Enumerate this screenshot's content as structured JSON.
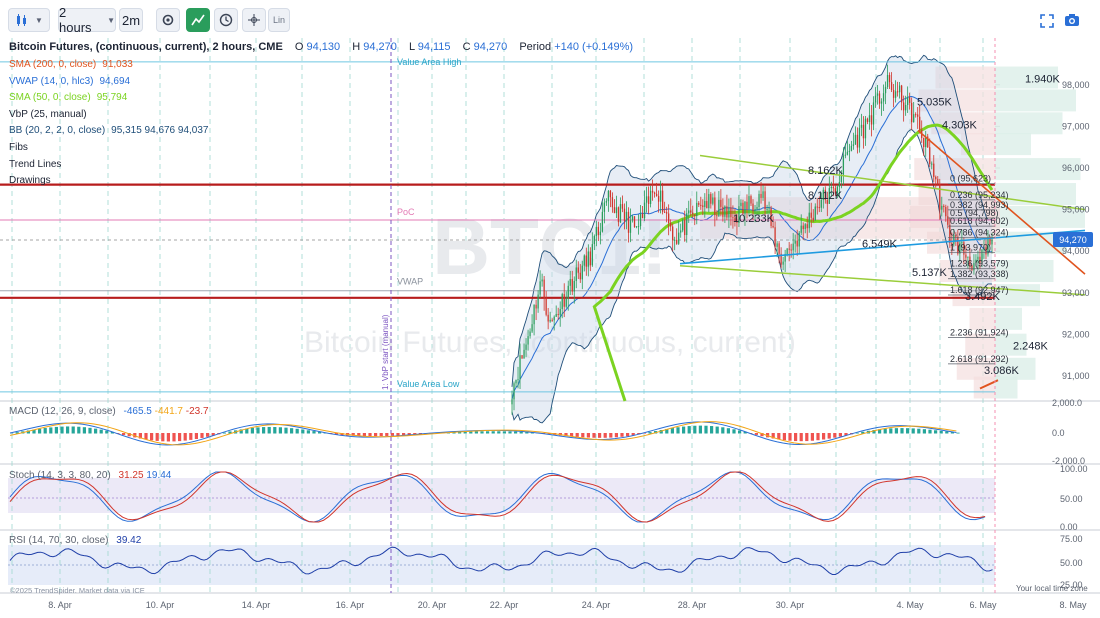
{
  "toolbar": {
    "interval": "2 hours",
    "refresh": "2m",
    "log_label": "Lin"
  },
  "header": {
    "title": "Bitcoin Futures, (continuous, current), 2 hours, CME",
    "open_key": "O",
    "open": "94,130",
    "high_key": "H",
    "high": "94,270",
    "low_key": "L",
    "low": "94,115",
    "close_key": "C",
    "close": "94,270",
    "period_key": "Period",
    "period": "+140 (+0.149%)"
  },
  "legend": [
    {
      "name": "SMA (200, 0, close)",
      "value": "91,033",
      "color": "#e0541f"
    },
    {
      "name": "VWAP (14, 0, hlc3)",
      "value": "94,694",
      "color": "#2a6fd6"
    },
    {
      "name": "SMA (50, 0, close)",
      "value": "95,794",
      "color": "#7bd321"
    },
    {
      "name": "VbP (25, manual)",
      "value": "",
      "color": "#1c2333"
    },
    {
      "name": "BB (20, 2, 2, 0, close)",
      "value": "95,315 94,676 94,037",
      "color": "#1f4e79"
    },
    {
      "name": "Fibs",
      "value": "",
      "color": "#1c2333"
    },
    {
      "name": "Trend Lines",
      "value": "",
      "color": "#1c2333"
    },
    {
      "name": "Drawings",
      "value": "",
      "color": "#1c2333"
    }
  ],
  "annotations": {
    "value_area_high": "Value Area High",
    "poc": "PoC",
    "vwap": "VWAP",
    "value_area_low": "Value Area Low",
    "vbp_start": "1: VbP start (manual)",
    "watermark_symbol": "BTC1!",
    "watermark_name": "Bitcoin Futures, (continuous, current)",
    "copyright": "©2025 TrendSpider. Market data via ICE",
    "local_time": "Your local time zone"
  },
  "fibs": [
    {
      "label": "0 (95,623)",
      "price": 95623
    },
    {
      "label": "0.236 (95,234)",
      "price": 95234
    },
    {
      "label": "0.382 (94,993)",
      "price": 94993
    },
    {
      "label": "0.5 (94,798)",
      "price": 94798
    },
    {
      "label": "0.618 (94,602)",
      "price": 94602
    },
    {
      "label": "0.786 (94,324)",
      "price": 94324
    },
    {
      "label": "1 (93,970)",
      "price": 93970
    },
    {
      "label": "1.236 (93,579)",
      "price": 93579
    },
    {
      "label": "1.382 (93,338)",
      "price": 93338
    },
    {
      "label": "1.618 (92,947)",
      "price": 92947
    },
    {
      "label": "2.236 (91,924)",
      "price": 91924
    },
    {
      "label": "2.618 (91,292)",
      "price": 91292
    }
  ],
  "volume_labels": [
    {
      "label": "1.940K",
      "price": 98150
    },
    {
      "label": "5.035K",
      "price": 97600
    },
    {
      "label": "4.303K",
      "price": 97050
    },
    {
      "label": "8.162K",
      "price": 95950
    },
    {
      "label": "8.112K",
      "price": 95350
    },
    {
      "label": "10.233K",
      "price": 94800
    },
    {
      "label": "6.549K",
      "price": 94180
    },
    {
      "label": "5.137K",
      "price": 93500
    },
    {
      "label": "3.492K",
      "price": 92920
    },
    {
      "label": "2.248K",
      "price": 91730
    },
    {
      "label": "3.086K",
      "price": 91150
    }
  ],
  "chart_data": {
    "type": "candlestick",
    "symbol": "BTC1!",
    "timeframe": "2 hours",
    "x_ticks": [
      "8. Apr",
      "10. Apr",
      "14. Apr",
      "16. Apr",
      "20. Apr",
      "22. Apr",
      "24. Apr",
      "28. Apr",
      "30. Apr",
      "4. May",
      "6. May",
      "8. May"
    ],
    "price_axis": {
      "ticks": [
        91000,
        92000,
        93000,
        94000,
        95000,
        96000,
        97000,
        98000
      ],
      "ylim": [
        90400,
        99100
      ],
      "last_price": "94,270"
    },
    "key_levels": {
      "value_area_high": 98550,
      "poc": 94750,
      "vwap": 93050,
      "value_area_low": 90620,
      "resistance_red_upper": 95600,
      "support_red_lower": 92880,
      "last_price": 94270
    },
    "closes_anchor_path": [
      [
        0,
        90700
      ],
      [
        3,
        91800
      ],
      [
        6,
        93300
      ],
      [
        8,
        92200
      ],
      [
        12,
        93200
      ],
      [
        16,
        93800
      ],
      [
        20,
        95200
      ],
      [
        26,
        94500
      ],
      [
        30,
        95600
      ],
      [
        34,
        94300
      ],
      [
        40,
        95200
      ],
      [
        46,
        94800
      ],
      [
        52,
        95400
      ],
      [
        56,
        93800
      ],
      [
        60,
        94400
      ],
      [
        64,
        95200
      ],
      [
        67,
        95400
      ],
      [
        70,
        96400
      ],
      [
        74,
        97100
      ],
      [
        78,
        98000
      ],
      [
        81,
        97700
      ],
      [
        84,
        97200
      ],
      [
        87,
        96300
      ],
      [
        89,
        95300
      ],
      [
        91,
        94400
      ],
      [
        94,
        94000
      ],
      [
        97,
        93600
      ],
      [
        100,
        94270
      ]
    ],
    "macd": {
      "params": "MACD (12, 26, 9, close)",
      "macd": "-465.5",
      "signal": "-441.7",
      "hist": "-23.7",
      "ticks": [
        "2,000.0",
        "0.0",
        "-2,000.0"
      ]
    },
    "stoch": {
      "params": "Stoch (14, 3, 3, 80, 20)",
      "k": "31.25",
      "d": "19.44",
      "ticks": [
        "100.00",
        "50.00",
        "0.00"
      ]
    },
    "rsi": {
      "params": "RSI (14, 70, 30, close)",
      "value": "39.42",
      "ticks": [
        "75.00",
        "50.00",
        "25.00"
      ]
    }
  }
}
